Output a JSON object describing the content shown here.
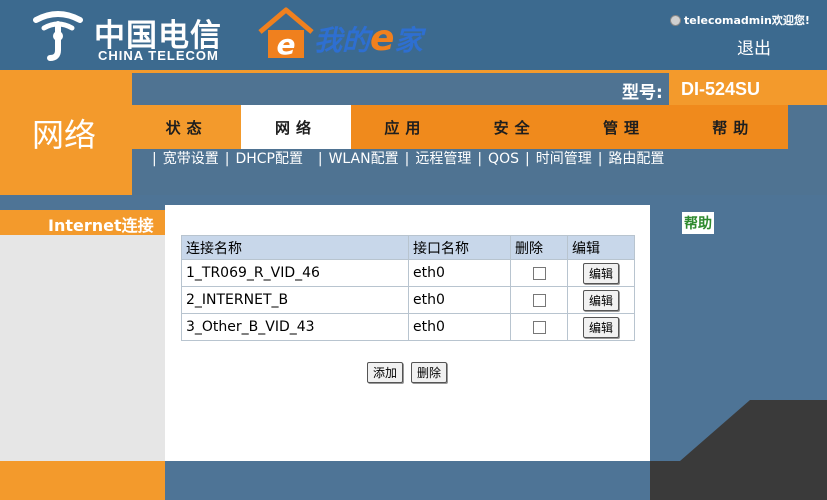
{
  "header": {
    "brand_cn": "中国电信",
    "brand_en": "CHINA TELECOM",
    "product_word": "我的",
    "product_e": "e",
    "product_tail": "家",
    "welcome": "telecomadmin欢迎您!",
    "logout": "退出"
  },
  "section": {
    "title": "网络"
  },
  "model": {
    "label": "型号:",
    "value": "DI-524SU"
  },
  "tabs": [
    {
      "label": "状态"
    },
    {
      "label": "网络"
    },
    {
      "label": "应用"
    },
    {
      "label": "安全"
    },
    {
      "label": "管理"
    },
    {
      "label": "帮助"
    }
  ],
  "subnav": [
    "宽带设置",
    "DHCP配置",
    "WLAN配置",
    "远程管理",
    "QOS",
    "时间管理",
    "路由配置"
  ],
  "sidebar": {
    "current": "Internet连接"
  },
  "table": {
    "headers": [
      "连接名称",
      "接口名称",
      "删除",
      "编辑"
    ],
    "edit_label": "编辑",
    "rows": [
      {
        "name": "1_TR069_R_VID_46",
        "iface": "eth0"
      },
      {
        "name": "2_INTERNET_B",
        "iface": "eth0"
      },
      {
        "name": "3_Other_B_VID_43",
        "iface": "eth0"
      }
    ]
  },
  "actions": {
    "add": "添加",
    "delete": "删除"
  },
  "help": {
    "title": "帮助"
  },
  "colors": {
    "orange": "#f39a2c",
    "blue": "#4e7496",
    "header_blue": "#3c6a8f"
  }
}
